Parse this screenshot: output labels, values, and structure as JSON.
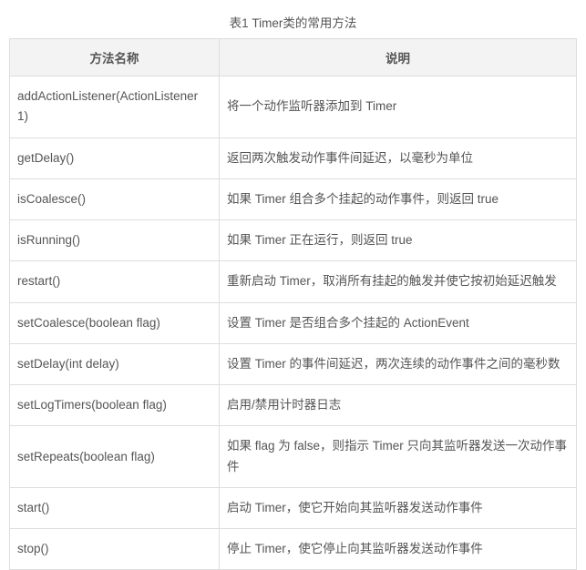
{
  "caption": "表1 Timer类的常用方法",
  "headers": {
    "name": "方法名称",
    "desc": "说明"
  },
  "rows": [
    {
      "name": "addActionListener(ActionListener 1)",
      "desc": "将一个动作监听器添加到 Timer"
    },
    {
      "name": "getDelay()",
      "desc": "返回两次触发动作事件间延迟，以毫秒为单位"
    },
    {
      "name": "isCoalesce()",
      "desc": "如果 Timer 组合多个挂起的动作事件，则返回 true"
    },
    {
      "name": "isRunning()",
      "desc": "如果 Timer 正在运行，则返回 true"
    },
    {
      "name": "restart()",
      "desc": "重新启动 Timer，取消所有挂起的触发并使它按初始延迟触发"
    },
    {
      "name": "setCoalesce(boolean flag)",
      "desc": "设置 Timer 是否组合多个挂起的 ActionEvent"
    },
    {
      "name": "setDelay(int delay)",
      "desc": "设置 Timer 的事件间延迟，两次连续的动作事件之间的毫秒数"
    },
    {
      "name": "setLogTimers(boolean flag)",
      "desc": "启用/禁用计时器日志"
    },
    {
      "name": "setRepeats(boolean flag)",
      "desc": "如果 flag 为 false，则指示 Timer 只向其监听器发送一次动作事件"
    },
    {
      "name": "start()",
      "desc": "启动 Timer，使它开始向其监听器发送动作事件"
    },
    {
      "name": "stop()",
      "desc": "停止 Timer，使它停止向其监听器发送动作事件"
    }
  ]
}
